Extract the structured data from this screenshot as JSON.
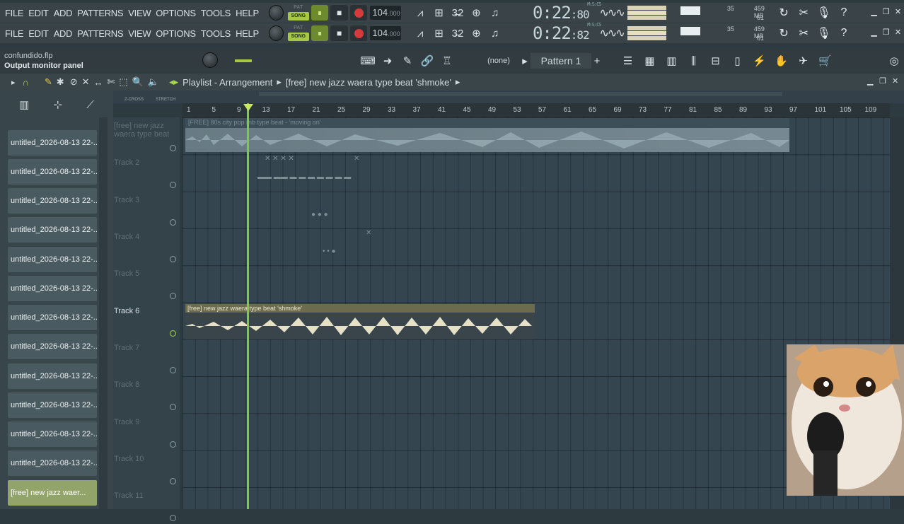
{
  "menu": [
    "FILE",
    "EDIT",
    "ADD",
    "PATTERNS",
    "VIEW",
    "OPTIONS",
    "TOOLS",
    "HELP"
  ],
  "transport": {
    "pat_label": "PAT",
    "song_label": "SONG",
    "play": "⏸",
    "stop": "■",
    "tempo": "104",
    "tempo_dec": ".000"
  },
  "time1": {
    "main": "0:22",
    "sub": ":80",
    "tag": "M:S:CS"
  },
  "time2": {
    "main": "0:22",
    "sub": ":82",
    "tag": "M:S:CS"
  },
  "cpu1": {
    "val": "35",
    "mem": "459 MB",
    "poly": "61"
  },
  "cpu2": {
    "val": "35",
    "mem": "459 MB",
    "poly": "61"
  },
  "hint": {
    "file": "confundido.flp",
    "title": "Output monitor panel"
  },
  "pattern": {
    "none": "(none)",
    "name": "Pattern 1",
    "add": "+"
  },
  "playlist": {
    "title": "Playlist - Arrangement",
    "clip": "[free] new jazz  waera type beat  'shmoke'"
  },
  "ruler": [
    "1",
    "5",
    "9",
    "13",
    "17",
    "21",
    "25",
    "29",
    "33",
    "37",
    "41",
    "45",
    "49",
    "53",
    "57",
    "61",
    "65",
    "69",
    "73",
    "77",
    "81",
    "85",
    "89",
    "93",
    "97",
    "101",
    "105",
    "109"
  ],
  "browser": [
    "untitled_2026-08-13 22-...",
    "untitled_2026-08-13 22-...",
    "untitled_2026-08-13 22-...",
    "untitled_2026-08-13 22-...",
    "untitled_2026-08-13 22-...",
    "untitled_2026-08-13 22-...",
    "untitled_2026-08-13 22-...",
    "untitled_2026-08-13 22-...",
    "untitled_2026-08-13 22-...",
    "untitled_2026-08-13 22-...",
    "untitled_2026-08-13 22-...",
    "untitled_2026-08-13 22-..."
  ],
  "browser_sel": "[free] new jazz  waer...",
  "tracks": [
    "Track 2",
    "Track 3",
    "Track 4",
    "Track 5",
    "Track 6",
    "Track 7",
    "Track 8",
    "Track 9",
    "Track 10",
    "Track 11"
  ],
  "track0": "[free] new jazz  waera type beat",
  "clip1_title": "[FREE] 80s city pop  rnb type beat - 'moving on'",
  "clip2_title": "[free] new jazz  waera type beat  'shmoke'",
  "tool_labels": {
    "zcross": "Z-CROSS",
    "stretch": "STRETCH"
  }
}
